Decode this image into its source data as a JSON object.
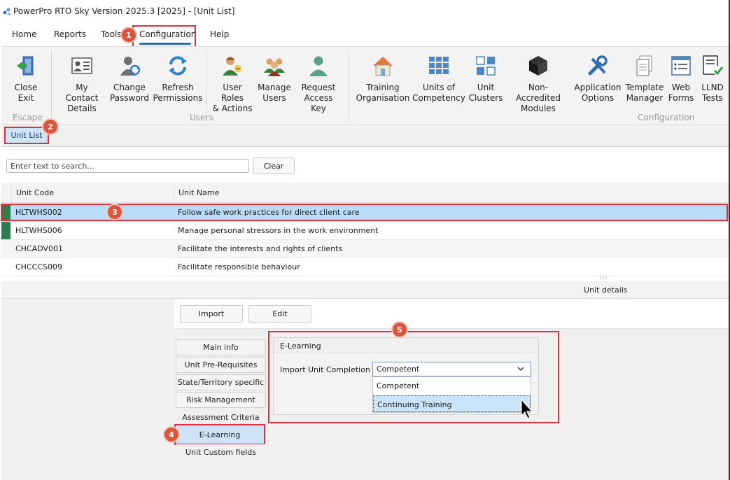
{
  "window": {
    "title": "PowerPro RTO Sky Version 2025.3 [2025] - [Unit List]"
  },
  "menu": [
    "Home",
    "Reports",
    "Tools",
    "Configuration",
    "Help"
  ],
  "ribbon": {
    "escape": {
      "group": "Escape",
      "buttons": [
        {
          "label": "Close\nExit",
          "icon": "close-exit-icon"
        }
      ]
    },
    "users": {
      "group": "Users",
      "buttons": [
        {
          "label": "My Contact\nDetails",
          "icon": "contact-card-icon"
        },
        {
          "label": "Change\nPassword",
          "icon": "change-password-icon"
        },
        {
          "label": "Refresh\nPermissions",
          "icon": "refresh-icon"
        },
        {
          "label": "User Roles\n& Actions",
          "icon": "user-roles-icon"
        },
        {
          "label": "Manage\nUsers",
          "icon": "manage-users-icon"
        },
        {
          "label": "Request\nAccess Key",
          "icon": "request-key-icon"
        }
      ]
    },
    "configuration": {
      "group": "Configuration",
      "buttons": [
        {
          "label": "Training\nOrganisation",
          "icon": "house-icon"
        },
        {
          "label": "Units of\nCompetency",
          "icon": "grid-icon"
        },
        {
          "label": "Unit\nClusters",
          "icon": "clusters-icon"
        },
        {
          "label": "Non-Accredited\nModules",
          "icon": "cube-icon"
        },
        {
          "label": "Application\nOptions",
          "icon": "tools-icon"
        },
        {
          "label": "Template\nManager",
          "icon": "template-icon"
        },
        {
          "label": "Web\nForms",
          "icon": "web-forms-icon"
        },
        {
          "label": "LLND\nTests",
          "icon": "llnd-tests-icon"
        }
      ]
    }
  },
  "doc_tab": "Unit List",
  "search": {
    "placeholder": "Enter text to search...",
    "clear_label": "Clear"
  },
  "table": {
    "columns": [
      "Unit Code",
      "Unit Name"
    ],
    "rows": [
      {
        "code": "HLTWHS002",
        "name": "Follow safe work practices for direct client care"
      },
      {
        "code": "HLTWHS006",
        "name": "Manage personal stressors in the work environment"
      },
      {
        "code": "CHCADV001",
        "name": "Facilitate the interests and rights of clients"
      },
      {
        "code": "CHCCCS009",
        "name": "Facilitate responsible behaviour"
      }
    ]
  },
  "details_label": "Unit details",
  "toolbar": {
    "import_label": "Import",
    "edit_label": "Edit"
  },
  "side_tabs": [
    "Main info",
    "Unit Pre-Requisites",
    "State/Territory specific",
    "Risk Management",
    "Assessment Criteria",
    "E-Learning",
    "Unit Custom fields"
  ],
  "elearning": {
    "title": "E-Learning",
    "field_label": "Import Unit Completion as",
    "selected": "Competent",
    "options": [
      "Competent",
      "Continuing Training"
    ]
  },
  "badges": [
    "1",
    "2",
    "3",
    "4",
    "5"
  ],
  "colors": {
    "highlight": "#e0303a",
    "badge": "#d9553d",
    "selection": "#cce4f7",
    "row_marker": "#2e7d4f"
  }
}
